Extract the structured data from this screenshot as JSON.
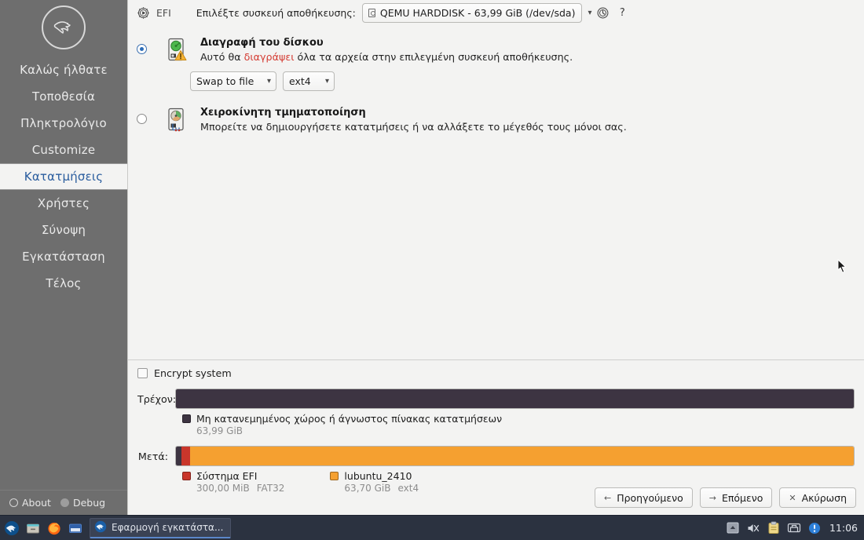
{
  "sidebar": {
    "logo_icon": "lubuntu-bird-logo",
    "items": [
      {
        "label": "Καλώς ήλθατε",
        "active": false
      },
      {
        "label": "Τοποθεσία",
        "active": false
      },
      {
        "label": "Πληκτρολόγιο",
        "active": false
      },
      {
        "label": "Customize",
        "active": false
      },
      {
        "label": "Κατατμήσεις",
        "active": true
      },
      {
        "label": "Χρήστες",
        "active": false
      },
      {
        "label": "Σύνοψη",
        "active": false
      },
      {
        "label": "Εγκατάσταση",
        "active": false
      },
      {
        "label": "Τέλος",
        "active": false
      }
    ],
    "bottom": {
      "about_label": "About",
      "about_icon": "info-icon",
      "debug_label": "Debug",
      "debug_icon": "debug-dot-icon"
    }
  },
  "toolbar": {
    "boot_icon": "efi-boot-icon",
    "boot_label": "EFI",
    "device_prompt": "Επιλέξτε συσκευή αποθήκευσης:",
    "device_selected": "QEMU HARDDISK - 63,99 GiB (/dev/sda)",
    "device_icon": "hard-disk-icon",
    "revert_icon": "revert-clock-icon",
    "help_label": "?"
  },
  "options": {
    "erase": {
      "selected": true,
      "icon": "disk-erase-warning-icon",
      "title": "Διαγραφή του δίσκου",
      "desc_before": "Αυτό θα ",
      "desc_warn": "διαγράψει",
      "desc_after": " όλα τα αρχεία στην επιλεγμένη συσκευή αποθήκευσης.",
      "swap_value": "Swap to file",
      "fs_value": "ext4"
    },
    "manual": {
      "selected": false,
      "icon": "disk-manual-partition-icon",
      "title": "Χειροκίνητη τμηματοποίηση",
      "desc": "Μπορείτε να δημιουργήσετε κατατμήσεις ή να αλλάξετε το μέγεθός τους μόνοι σας."
    }
  },
  "preview": {
    "encrypt_label": "Encrypt system",
    "encrypt_checked": false,
    "before": {
      "label": "Τρέχον:",
      "segments": [
        {
          "name": "Μη κατανεμημένος χώρος ή άγνωστος πίνακας κατατμήσεων",
          "size": "63,99 GiB",
          "fs": "",
          "color": "#3d3442",
          "percent": 100
        }
      ]
    },
    "after": {
      "label": "Μετά:",
      "segments": [
        {
          "name": "",
          "size": "",
          "fs": "",
          "color": "#3d3442",
          "percent": 0.8,
          "in_legend": false
        },
        {
          "name": "Σύστημα EFI",
          "size": "300,00 MiB",
          "fs": "FAT32",
          "color": "#c9362b",
          "percent": 1.3,
          "in_legend": true
        },
        {
          "name": "lubuntu_2410",
          "size": "63,70 GiB",
          "fs": "ext4",
          "color": "#f5a030",
          "percent": 97.9,
          "in_legend": true
        }
      ]
    }
  },
  "nav_buttons": [
    {
      "label": "Προηγούμενο",
      "icon": "arrow-left-icon"
    },
    {
      "label": "Επόμενο",
      "icon": "arrow-right-icon"
    },
    {
      "label": "Ακύρωση",
      "icon": "close-x-icon"
    }
  ],
  "taskbar": {
    "launchers": [
      {
        "name": "lubuntu-start-menu-icon"
      },
      {
        "name": "file-manager-icon"
      },
      {
        "name": "firefox-icon"
      },
      {
        "name": "terminal-icon"
      }
    ],
    "window_button": {
      "icon": "calamares-installer-icon",
      "label": "Εφαρμογή εγκατάστα..."
    },
    "tray": [
      {
        "name": "show-hidden-icons-icon"
      },
      {
        "name": "volume-muted-icon"
      },
      {
        "name": "clipboard-icon"
      },
      {
        "name": "network-icon"
      },
      {
        "name": "updates-available-icon"
      }
    ],
    "clock": "11:06"
  }
}
